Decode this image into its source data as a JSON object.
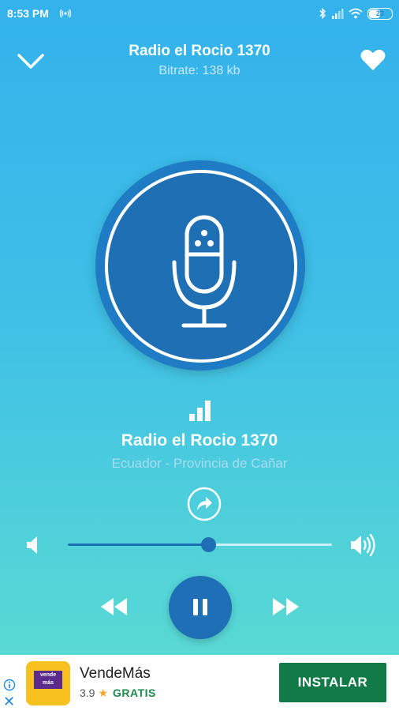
{
  "status_bar": {
    "time": "8:53 PM",
    "battery": "23"
  },
  "header": {
    "title": "Radio el Rocio 1370",
    "subtitle": "Bitrate: 138 kb"
  },
  "station": {
    "name": "Radio el Rocio 1370",
    "location": "Ecuador - Provincia de Cañar"
  },
  "player": {
    "volume_fraction": 0.53,
    "state": "playing"
  },
  "ad": {
    "app_name": "VendeMás",
    "rating": "3.9",
    "price": "GRATIS",
    "install_label": "INSTALAR",
    "logo_text": "vende más"
  },
  "colors": {
    "accent": "#1f6fb5",
    "install": "#127a46",
    "star": "#f5a623"
  },
  "icons": [
    "chevron-down-icon",
    "heart-icon",
    "microphone-icon",
    "signal-bars-icon",
    "share-icon",
    "volume-low-icon",
    "volume-high-icon",
    "rewind-icon",
    "pause-icon",
    "fast-forward-icon",
    "info-icon",
    "close-icon"
  ]
}
